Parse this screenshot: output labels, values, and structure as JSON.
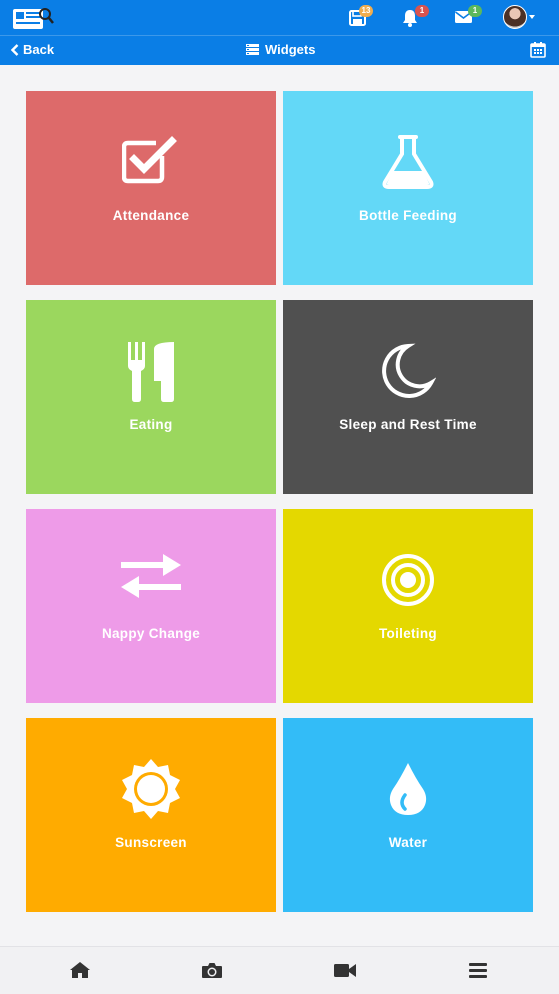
{
  "header": {
    "notifications": [
      {
        "name": "save-icon",
        "count": "13",
        "color": "#f0ad4e"
      },
      {
        "name": "bell-icon",
        "count": "1",
        "color": "#d9534f"
      },
      {
        "name": "envelope-icon",
        "count": "1",
        "color": "#5cb85c"
      }
    ]
  },
  "nav": {
    "back_label": "Back",
    "title": "Widgets"
  },
  "widgets": [
    {
      "label": "Attendance",
      "icon": "checkbox-icon",
      "color": "#dd6a6a"
    },
    {
      "label": "Bottle Feeding",
      "icon": "flask-icon",
      "color": "#63d8f7"
    },
    {
      "label": "Eating",
      "icon": "cutlery-icon",
      "color": "#9bd75e"
    },
    {
      "label": "Sleep and Rest Time",
      "icon": "moon-icon",
      "color": "#505050"
    },
    {
      "label": "Nappy Change",
      "icon": "swap-arrows-icon",
      "color": "#ee9be8"
    },
    {
      "label": "Toileting",
      "icon": "target-icon",
      "color": "#e4d800"
    },
    {
      "label": "Sunscreen",
      "icon": "sun-icon",
      "color": "#ffab00"
    },
    {
      "label": "Water",
      "icon": "water-drop-icon",
      "color": "#33bcf7"
    }
  ],
  "colors": {
    "brand": "#0a7ee6"
  }
}
